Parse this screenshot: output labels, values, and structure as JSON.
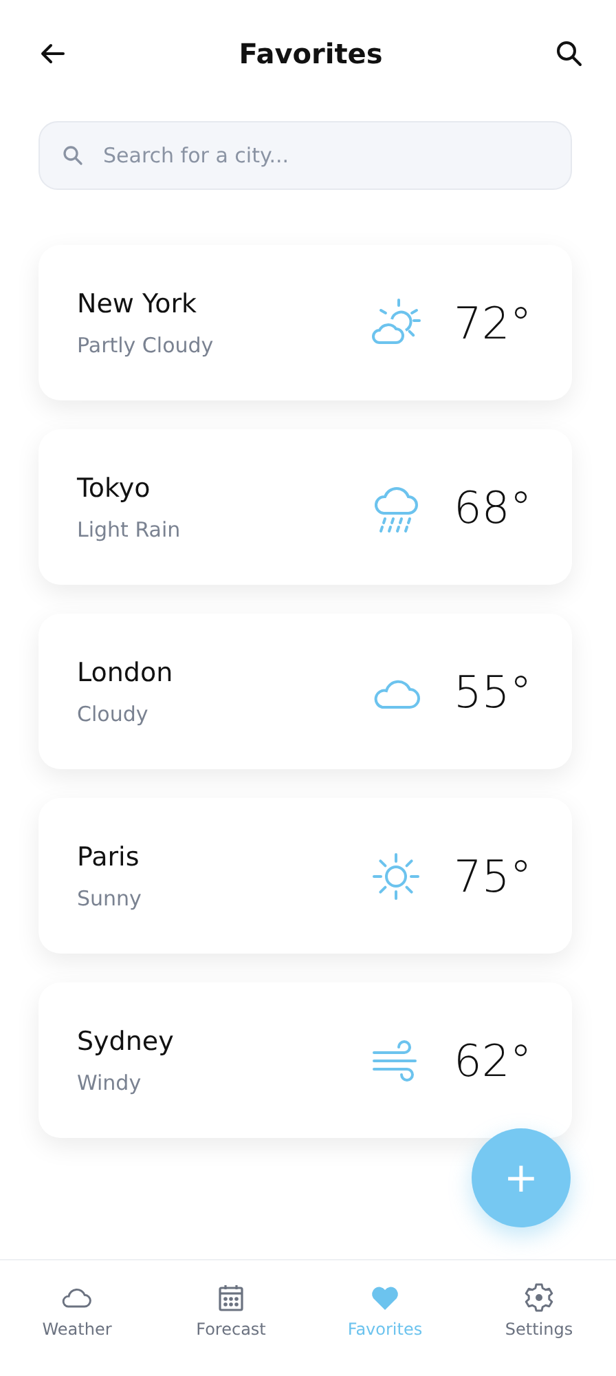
{
  "header": {
    "title": "Favorites"
  },
  "search": {
    "placeholder": "Search for a city..."
  },
  "cities": [
    {
      "name": "New York",
      "condition": "Partly Cloudy",
      "kind": "partly-cloudy",
      "temperature": "72°"
    },
    {
      "name": "Tokyo",
      "condition": "Light Rain",
      "kind": "rain",
      "temperature": "68°"
    },
    {
      "name": "London",
      "condition": "Cloudy",
      "kind": "cloudy",
      "temperature": "55°"
    },
    {
      "name": "Paris",
      "condition": "Sunny",
      "kind": "sunny",
      "temperature": "75°"
    },
    {
      "name": "Sydney",
      "condition": "Windy",
      "kind": "windy",
      "temperature": "62°"
    }
  ],
  "fab": {
    "label": "+"
  },
  "nav": [
    {
      "label": "Weather",
      "kind": "cloud",
      "selected": false
    },
    {
      "label": "Forecast",
      "kind": "calendar",
      "selected": false
    },
    {
      "label": "Favorites",
      "kind": "heart",
      "selected": true
    },
    {
      "label": "Settings",
      "kind": "gear",
      "selected": false
    }
  ]
}
